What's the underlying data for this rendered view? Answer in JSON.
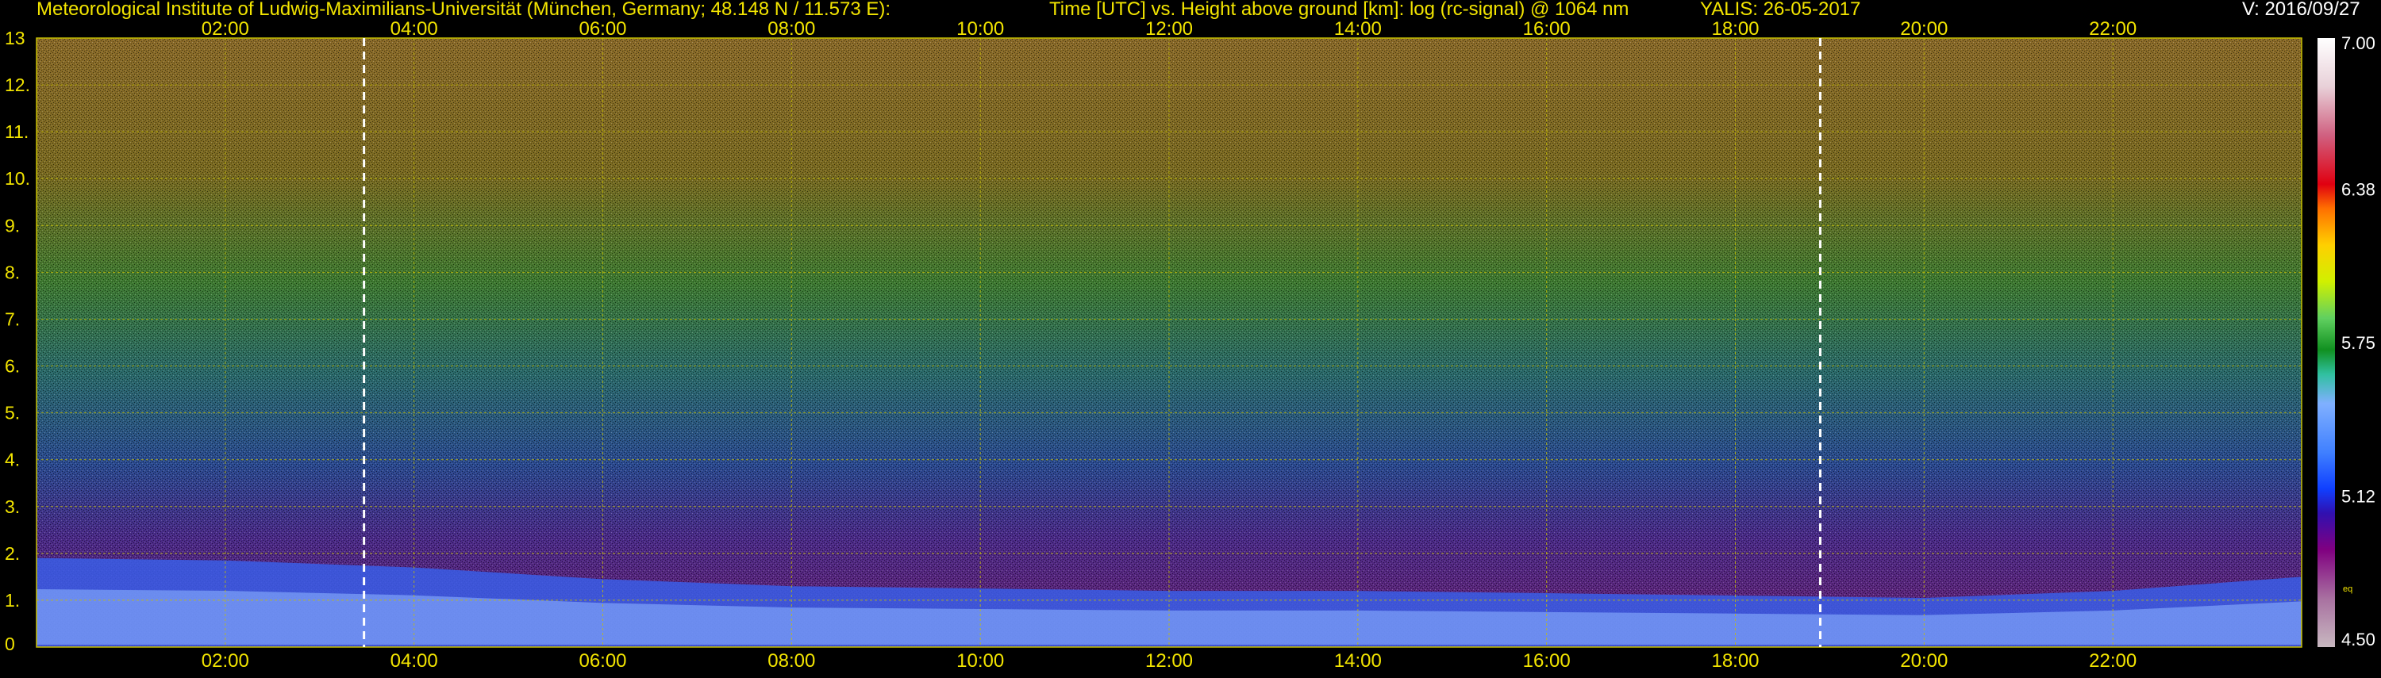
{
  "header": {
    "institute": "Meteorological Institute of Ludwig-Maximilians-Universität (München, Germany; 48.148 N / 11.573 E):",
    "description": "Time [UTC] vs. Height above ground [km]: log (rc-signal) @ 1064 nm",
    "instrument": "YALIS: 26-05-2017",
    "version": "V: 2016/09/27"
  },
  "colors": {
    "background": "#000000",
    "title_text": "#f2e400",
    "axis_text": "#f2e400",
    "grid": "#c8c000",
    "marker_line": "#ffffff",
    "version_text": "#ffffff"
  },
  "chart_data": {
    "type": "heatmap",
    "title": "Time [UTC] vs. Height above ground [km]: log (rc-signal) @ 1064 nm",
    "xlabel": "",
    "ylabel": "",
    "x_range_hours_utc": [
      0,
      24
    ],
    "y_range_km": [
      0,
      13
    ],
    "x_ticks": [
      "02:00",
      "04:00",
      "06:00",
      "08:00",
      "10:00",
      "12:00",
      "14:00",
      "16:00",
      "18:00",
      "20:00",
      "22:00"
    ],
    "x_tick_hours": [
      2,
      4,
      6,
      8,
      10,
      12,
      14,
      16,
      18,
      20,
      22
    ],
    "y_ticks": [
      "0",
      "1.",
      "2.",
      "3.",
      "4.",
      "5.",
      "6.",
      "7.",
      "8.",
      "9.",
      "10.",
      "11.",
      "12.",
      "13"
    ],
    "y_tick_values": [
      0,
      1,
      2,
      3,
      4,
      5,
      6,
      7,
      8,
      9,
      10,
      11,
      12,
      13
    ],
    "grid": true,
    "markers_hours_utc": [
      3.47,
      18.9
    ],
    "colorbar": {
      "range": [
        4.5,
        7.0
      ],
      "tick_labels": [
        "7.00",
        "6.38",
        "5.75",
        "5.12",
        "4.50"
      ],
      "tick_values": [
        7.0,
        6.38,
        5.75,
        5.12,
        4.5
      ],
      "extra_label": "eq",
      "color_stops": [
        {
          "value": 4.5,
          "color": "#c8b8c0"
        },
        {
          "value": 4.7,
          "color": "#a870a0"
        },
        {
          "value": 4.9,
          "color": "#800080"
        },
        {
          "value": 5.05,
          "color": "#3010b0"
        },
        {
          "value": 5.15,
          "color": "#1040ff"
        },
        {
          "value": 5.3,
          "color": "#4080ff"
        },
        {
          "value": 5.5,
          "color": "#80b0ff"
        },
        {
          "value": 5.62,
          "color": "#30c0a0"
        },
        {
          "value": 5.72,
          "color": "#109020"
        },
        {
          "value": 5.85,
          "color": "#60d060"
        },
        {
          "value": 6.0,
          "color": "#d0f000"
        },
        {
          "value": 6.15,
          "color": "#ffd000"
        },
        {
          "value": 6.3,
          "color": "#ff7000"
        },
        {
          "value": 6.4,
          "color": "#e00010"
        },
        {
          "value": 6.6,
          "color": "#d06080"
        },
        {
          "value": 6.8,
          "color": "#e8d0d8"
        },
        {
          "value": 7.0,
          "color": "#ffffff"
        }
      ]
    },
    "layer_top_km": [
      {
        "hour": 0.0,
        "km": 1.9
      },
      {
        "hour": 2.0,
        "km": 1.85
      },
      {
        "hour": 4.0,
        "km": 1.7
      },
      {
        "hour": 6.0,
        "km": 1.45
      },
      {
        "hour": 8.0,
        "km": 1.3
      },
      {
        "hour": 10.0,
        "km": 1.25
      },
      {
        "hour": 12.0,
        "km": 1.2
      },
      {
        "hour": 14.0,
        "km": 1.2
      },
      {
        "hour": 16.0,
        "km": 1.15
      },
      {
        "hour": 18.0,
        "km": 1.1
      },
      {
        "hour": 20.0,
        "km": 1.05
      },
      {
        "hour": 22.0,
        "km": 1.2
      },
      {
        "hour": 24.0,
        "km": 1.5
      }
    ]
  }
}
